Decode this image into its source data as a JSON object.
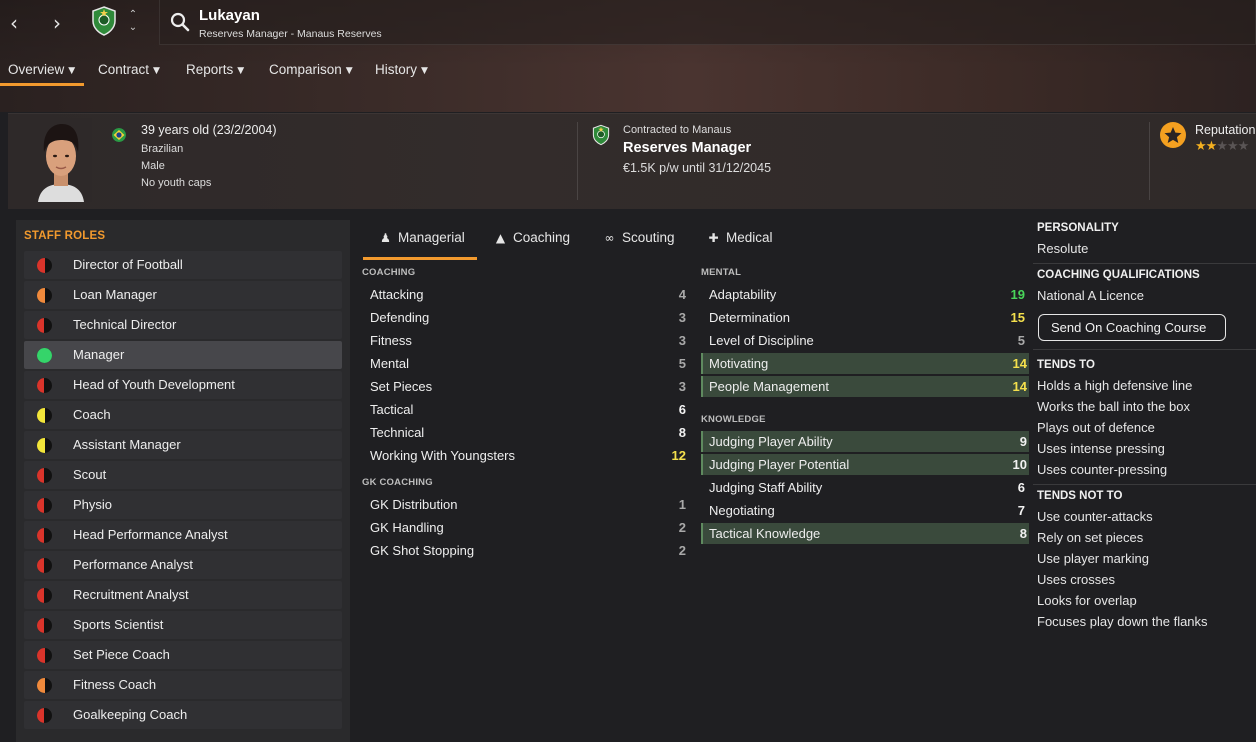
{
  "header": {
    "name": "Lukayan",
    "subtitle": "Reserves Manager - Manaus Reserves"
  },
  "tabs": [
    {
      "label": "Overview",
      "active": true
    },
    {
      "label": "Contract"
    },
    {
      "label": "Reports"
    },
    {
      "label": "Comparison"
    },
    {
      "label": "History"
    }
  ],
  "profile": {
    "age": "39 years old (23/2/2004)",
    "nationality": "Brazilian",
    "gender": "Male",
    "youth_caps": "No youth caps"
  },
  "contract": {
    "contracted_to": "Contracted to Manaus",
    "role": "Reserves Manager",
    "wage": "€1.5K p/w until 31/12/2045"
  },
  "reputation": {
    "label": "Reputation",
    "stars_filled": 2,
    "stars_total": 5
  },
  "roles": {
    "title": "STAFF ROLES",
    "items": [
      {
        "label": "Director of Football",
        "color": "#d9342b",
        "fill": "half"
      },
      {
        "label": "Loan Manager",
        "color": "#f08a3c",
        "fill": "half"
      },
      {
        "label": "Technical Director",
        "color": "#d9342b",
        "fill": "quarter"
      },
      {
        "label": "Manager",
        "color": "#35d46a",
        "fill": "full",
        "selected": true
      },
      {
        "label": "Head of Youth Development",
        "color": "#d9342b",
        "fill": "quarter"
      },
      {
        "label": "Coach",
        "color": "#f2e53a",
        "fill": "half"
      },
      {
        "label": "Assistant Manager",
        "color": "#f2e53a",
        "fill": "half"
      },
      {
        "label": "Scout",
        "color": "#d9342b",
        "fill": "quarter"
      },
      {
        "label": "Physio",
        "color": "#d9342b",
        "fill": "quarter"
      },
      {
        "label": "Head Performance Analyst",
        "color": "#d9342b",
        "fill": "quarter"
      },
      {
        "label": "Performance Analyst",
        "color": "#d9342b",
        "fill": "quarter"
      },
      {
        "label": "Recruitment Analyst",
        "color": "#d9342b",
        "fill": "quarter"
      },
      {
        "label": "Sports Scientist",
        "color": "#d9342b",
        "fill": "quarter"
      },
      {
        "label": "Set Piece Coach",
        "color": "#d9342b",
        "fill": "half"
      },
      {
        "label": "Fitness Coach",
        "color": "#f08a3c",
        "fill": "half"
      },
      {
        "label": "Goalkeeping Coach",
        "color": "#d9342b",
        "fill": "quarter"
      }
    ]
  },
  "attr_tabs": [
    {
      "label": "Managerial",
      "icon": "person-icon",
      "active": true
    },
    {
      "label": "Coaching",
      "icon": "cones-icon"
    },
    {
      "label": "Scouting",
      "icon": "binoculars-icon"
    },
    {
      "label": "Medical",
      "icon": "medkit-icon"
    }
  ],
  "coaching": {
    "title": "COACHING",
    "items": [
      {
        "label": "Attacking",
        "value": "4",
        "tone": "dim"
      },
      {
        "label": "Defending",
        "value": "3",
        "tone": "dim"
      },
      {
        "label": "Fitness",
        "value": "3",
        "tone": "dim"
      },
      {
        "label": "Mental",
        "value": "5",
        "tone": "dim"
      },
      {
        "label": "Set Pieces",
        "value": "3",
        "tone": "dim"
      },
      {
        "label": "Tactical",
        "value": "6",
        "tone": "white"
      },
      {
        "label": "Technical",
        "value": "8",
        "tone": "white"
      },
      {
        "label": "Working With Youngsters",
        "value": "12",
        "tone": "yellow"
      }
    ]
  },
  "gk_coaching": {
    "title": "GK COACHING",
    "items": [
      {
        "label": "GK Distribution",
        "value": "1",
        "tone": "dim"
      },
      {
        "label": "GK Handling",
        "value": "2",
        "tone": "dim"
      },
      {
        "label": "GK Shot Stopping",
        "value": "2",
        "tone": "dim"
      }
    ]
  },
  "mental": {
    "title": "MENTAL",
    "items": [
      {
        "label": "Adaptability",
        "value": "19",
        "tone": "green"
      },
      {
        "label": "Determination",
        "value": "15",
        "tone": "yellow"
      },
      {
        "label": "Level of Discipline",
        "value": "5",
        "tone": "dim"
      },
      {
        "label": "Motivating",
        "value": "14",
        "tone": "yellow",
        "hl": true
      },
      {
        "label": "People Management",
        "value": "14",
        "tone": "yellow",
        "hl": true
      }
    ]
  },
  "knowledge": {
    "title": "KNOWLEDGE",
    "items": [
      {
        "label": "Judging Player Ability",
        "value": "9",
        "tone": "white",
        "hl": true
      },
      {
        "label": "Judging Player Potential",
        "value": "10",
        "tone": "white",
        "hl": true
      },
      {
        "label": "Judging Staff Ability",
        "value": "6",
        "tone": "white"
      },
      {
        "label": "Negotiating",
        "value": "7",
        "tone": "white"
      },
      {
        "label": "Tactical Knowledge",
        "value": "8",
        "tone": "white",
        "hl": true
      }
    ]
  },
  "right": {
    "personality_title": "PERSONALITY",
    "personality": "Resolute",
    "qual_title": "COACHING QUALIFICATIONS",
    "qual": "National A Licence",
    "course_button": "Send On Coaching Course",
    "tends_to_title": "TENDS TO",
    "tends_to": [
      "Holds a high defensive line",
      "Works the ball into the box",
      "Plays out of defence",
      "Uses intense pressing",
      "Uses counter-pressing"
    ],
    "tends_not_title": "TENDS NOT TO",
    "tends_not": [
      "Use counter-attacks",
      "Rely on set pieces",
      "Use player marking",
      "Uses crosses",
      "Looks for overlap",
      "Focuses play down the flanks"
    ]
  },
  "colors": {
    "accent": "#f29a2e",
    "highlight_row": "#3a4a3c"
  }
}
